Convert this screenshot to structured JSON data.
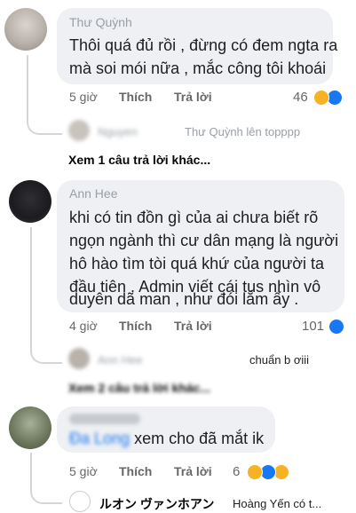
{
  "comments": [
    {
      "author": "Thư Quỳnh",
      "lines": [
        "Thôi quá đủ rồi , đừng có đem ngta ra",
        "mà soi mói nữa , mắc công tôi khoái"
      ],
      "time": "5 giờ",
      "like_label": "Thích",
      "reply_label": "Trả lời",
      "reaction_count": "46",
      "reactions": [
        "haha",
        "like"
      ],
      "reply_preview": {
        "author": "Nguyen",
        "text": "Thư Quỳnh lên topppp"
      },
      "more_replies": "Xem 1 câu trả lời khác..."
    },
    {
      "author": "Ann Hee",
      "lines": [
        "khi có tin đồn gì của ai chưa biết rõ",
        "ngọn ngành thì cư dân mạng là người",
        "hô hào tìm tòi quá khứ của người ta",
        "đầu tiên . Admin viết cái tus nhìn vô",
        "duyên dã man , như đói lắm ấy ."
      ],
      "time": "4 giờ",
      "like_label": "Thích",
      "reply_label": "Trả lời",
      "reaction_count": "101",
      "reactions": [
        "like"
      ],
      "reply_preview": {
        "author": "Ann Hee",
        "text": "chuẩn b ơiii"
      },
      "more_replies": "Xem 2 câu trả lời khác..."
    },
    {
      "author": "",
      "mention": "Đa Long",
      "text": "xem cho đã mắt ik",
      "time": "5 giờ",
      "like_label": "Thích",
      "reply_label": "Trả lời",
      "reaction_count": "6",
      "reactions": [
        "haha",
        "like",
        "sad"
      ],
      "reply_preview": {
        "author": "ルオン ヴァンホアン",
        "text": "Hoàng Yến có t..."
      }
    }
  ],
  "colors": {
    "bubble": "#eef0f3",
    "like": "#1877f2",
    "haha": "#f7b125",
    "meta": "#65676b"
  }
}
